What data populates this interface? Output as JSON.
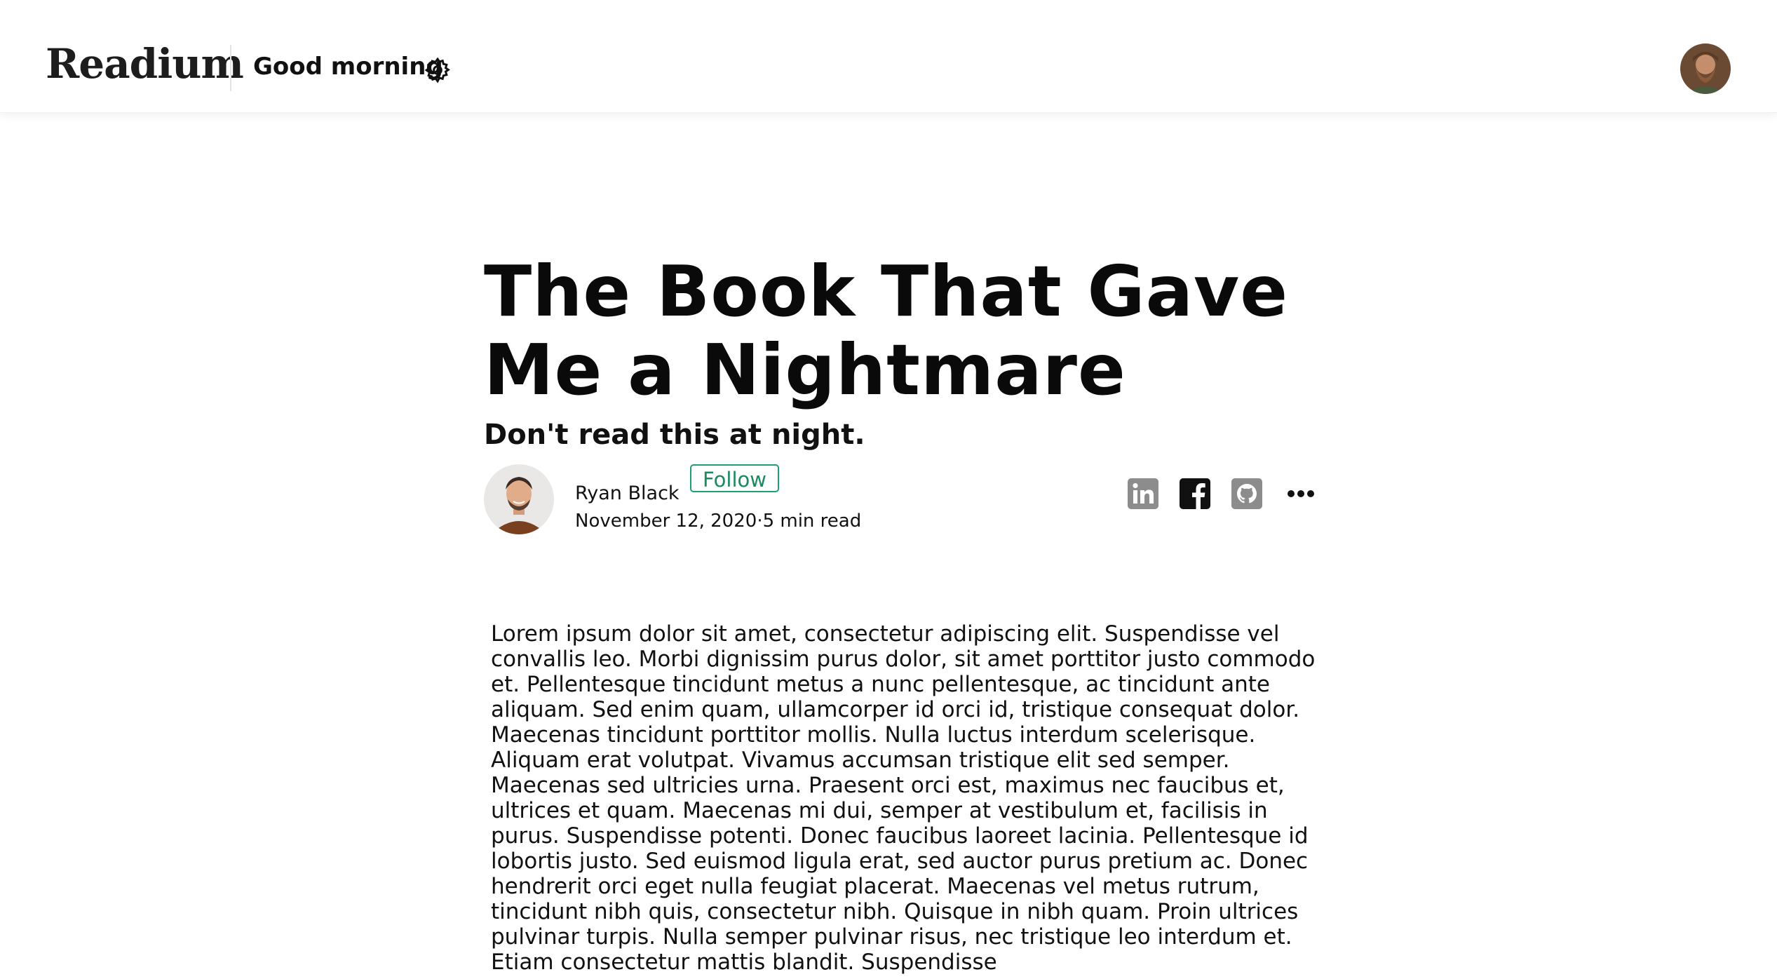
{
  "header": {
    "brand": "Readium",
    "greeting": "Good morning",
    "settings_icon": "gear-icon",
    "user_avatar": "user-avatar"
  },
  "article": {
    "title": "The Book That Gave Me a Nightmare",
    "subtitle": "Don't read this at night.",
    "author": {
      "name": "Ryan Black",
      "follow_label": "Follow",
      "date": "November 12, 2020",
      "separator": "·",
      "read_time": "5 min read"
    },
    "share_icons": [
      "linkedin-icon",
      "facebook-icon",
      "github-icon",
      "more-icon"
    ],
    "body": "Lorem ipsum dolor sit amet, consectetur adipiscing elit. Suspendisse vel convallis leo. Morbi dignissim purus dolor, sit amet porttitor justo commodo et. Pellentesque tincidunt metus a nunc pellentesque, ac tincidunt ante aliquam. Sed enim quam, ullamcorper id orci id, tristique consequat dolor. Maecenas tincidunt porttitor mollis. Nulla luctus interdum scelerisque. Aliquam erat volutpat. Vivamus accumsan tristique elit sed semper. Maecenas sed ultricies urna. Praesent orci est, maximus nec faucibus et, ultrices et quam. Maecenas mi dui, semper at vestibulum et, facilisis in purus. Suspendisse potenti. Donec faucibus laoreet lacinia. Pellentesque id lobortis justo. Sed euismod ligula erat, sed auctor purus pretium ac. Donec hendrerit orci eget nulla feugiat placerat. Maecenas vel metus rutrum, tincidunt nibh quis, consectetur nibh. Quisque in nibh quam. Proin ultrices pulvinar turpis. Nulla semper pulvinar risus, nec tristique leo interdum et. Etiam consectetur mattis blandit. Suspendisse"
  },
  "colors": {
    "follow_accent": "#1f9e6e",
    "icon_gray": "#8a8a8a",
    "text": "#111111"
  }
}
